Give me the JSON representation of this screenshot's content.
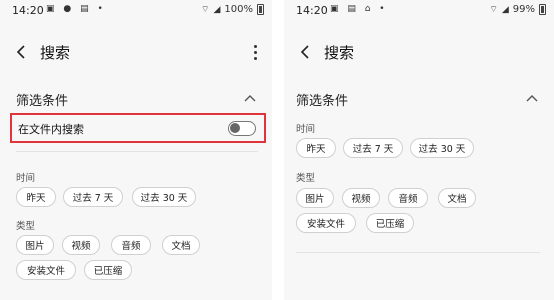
{
  "left": {
    "status": {
      "time": "14:20",
      "battery": "100%"
    },
    "appbar": {
      "title": "搜索"
    },
    "filter": {
      "title": "筛选条件",
      "toggle_label": "在文件内搜索",
      "time_label": "时间",
      "time_options": [
        "昨天",
        "过去 7 天",
        "过去 30 天"
      ],
      "type_label": "类型",
      "type_options": [
        "图片",
        "视频",
        "音频",
        "文档",
        "安装文件",
        "已压缩"
      ]
    }
  },
  "right": {
    "status": {
      "time": "14:20",
      "battery": "99%"
    },
    "appbar": {
      "title": "搜索"
    },
    "filter": {
      "title": "筛选条件",
      "time_label": "时间",
      "time_options": [
        "昨天",
        "过去 7 天",
        "过去 30 天"
      ],
      "type_label": "类型",
      "type_options": [
        "图片",
        "视频",
        "音频",
        "文档",
        "安装文件",
        "已压缩"
      ]
    }
  },
  "icons": {
    "back": "chevron-left-icon",
    "more": "more-vertical-icon",
    "collapse": "chevron-up-icon"
  },
  "colors": {
    "highlight": "#e0353b",
    "chip_border": "#d0d0d0"
  }
}
